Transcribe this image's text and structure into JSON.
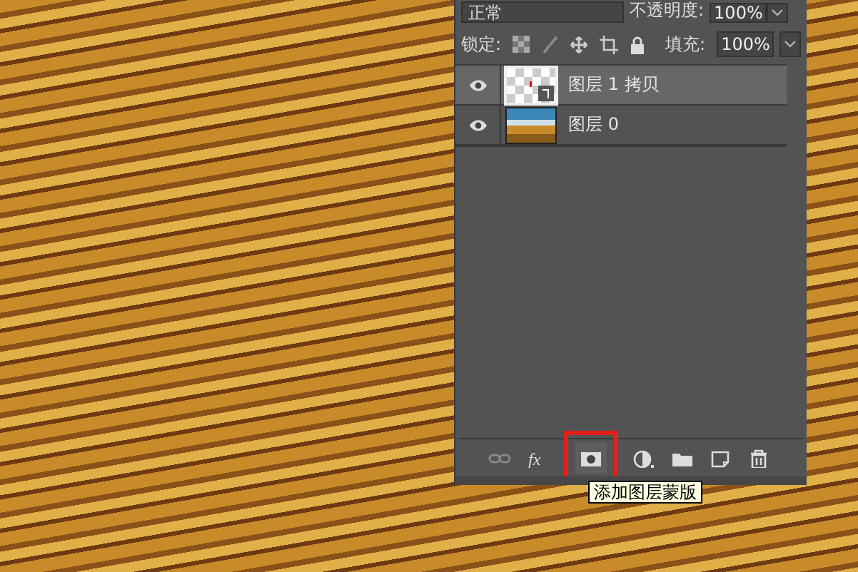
{
  "blend_mode": {
    "value": "正常"
  },
  "opacity": {
    "label": "不透明度:",
    "value": "100%"
  },
  "lock": {
    "label": "锁定:"
  },
  "fill": {
    "label": "填充:",
    "value": "100%"
  },
  "layers": [
    {
      "name": "图层 1 拷贝",
      "selected": true,
      "visible": true,
      "kind": "copy"
    },
    {
      "name": "图层 0",
      "selected": false,
      "visible": true,
      "kind": "photo"
    }
  ],
  "toolbar": [
    {
      "kind": "link",
      "disabled": true,
      "highlighted": false
    },
    {
      "kind": "fx",
      "disabled": false,
      "highlighted": false
    },
    {
      "kind": "mask",
      "disabled": false,
      "highlighted": true
    },
    {
      "kind": "adjust",
      "disabled": false,
      "highlighted": false
    },
    {
      "kind": "group",
      "disabled": false,
      "highlighted": false
    },
    {
      "kind": "new",
      "disabled": false,
      "highlighted": false
    },
    {
      "kind": "delete",
      "disabled": false,
      "highlighted": false
    }
  ],
  "tooltip": {
    "text": "添加图层蒙版"
  }
}
